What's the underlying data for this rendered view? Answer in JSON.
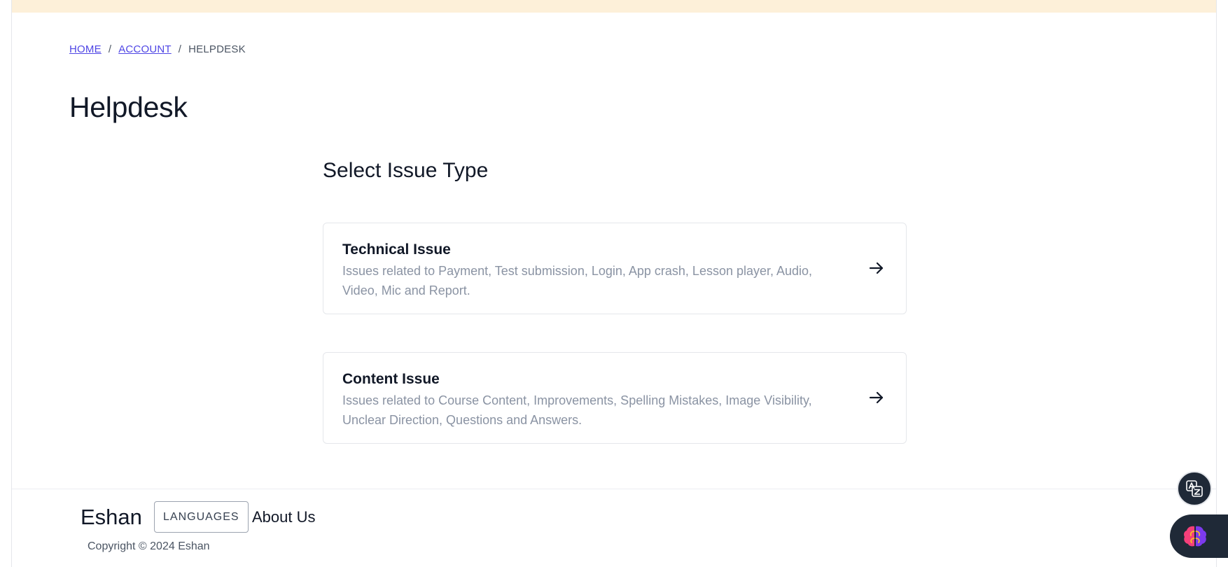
{
  "breadcrumb": {
    "home": "HOME",
    "separator": "/",
    "account": "ACCOUNT",
    "current": "HELPDESK"
  },
  "page": {
    "title": "Helpdesk",
    "section_title": "Select Issue Type"
  },
  "issues": [
    {
      "title": "Technical Issue",
      "description": "Issues related to Payment, Test submission, Login, App crash, Lesson player, Audio, Video, Mic and Report.",
      "icon": "arrow-right-icon"
    },
    {
      "title": "Content Issue",
      "description": "Issues related to Course Content, Improvements, Spelling Mistakes, Image Visibility, Unclear Direction, Questions and Answers.",
      "icon": "arrow-right-icon"
    }
  ],
  "footer": {
    "brand": "Eshan",
    "languages_label": "LANGUAGES",
    "about_label": "About Us",
    "copyright": "Copyright © 2024 Eshan"
  },
  "floating": {
    "translate_icon": "translate-icon",
    "ai_icon": "brain-icon"
  },
  "colors": {
    "link": "#4f46e5",
    "banner": "#fdf0d9",
    "text": "#111827",
    "muted": "#8a93a3",
    "floating_bg": "#1f2937"
  }
}
